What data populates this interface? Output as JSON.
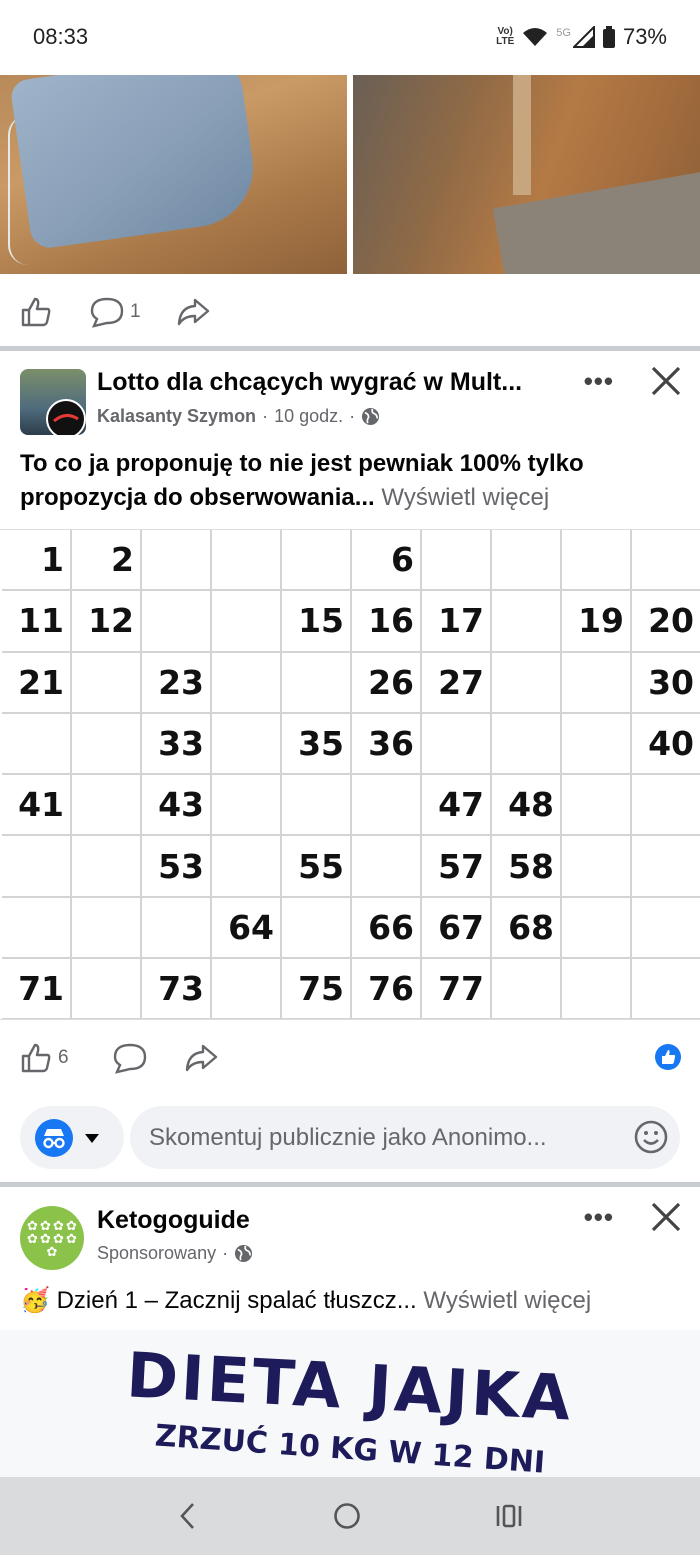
{
  "status_bar": {
    "time": "08:33",
    "network_top": "Vo)",
    "network_bottom": "LTE",
    "signal_5g": "5G",
    "battery": "73%"
  },
  "post1": {
    "comment_count": "1"
  },
  "post2": {
    "group_name": "Lotto dla chcących wygrać w Mult...",
    "author": "Kalasanty Szymon",
    "time": "10 godz.",
    "dot": "·",
    "body": "To co ja proponuję to nie jest pewniak 100% tylko propozycja do obserwowania...",
    "see_more": "Wyświetl więcej",
    "like_count": "6",
    "grid_rows": [
      [
        "1",
        "2",
        "",
        "",
        "",
        "6",
        "",
        "",
        "",
        ""
      ],
      [
        "11",
        "12",
        "",
        "",
        "15",
        "16",
        "17",
        "",
        "19",
        "20"
      ],
      [
        "21",
        "",
        "23",
        "",
        "",
        "26",
        "27",
        "",
        "",
        "30"
      ],
      [
        "",
        "",
        "33",
        "",
        "35",
        "36",
        "",
        "",
        "",
        "40"
      ],
      [
        "41",
        "",
        "43",
        "",
        "",
        "",
        "47",
        "48",
        "",
        ""
      ],
      [
        "",
        "",
        "53",
        "",
        "55",
        "",
        "57",
        "58",
        "",
        ""
      ],
      [
        "",
        "",
        "",
        "64",
        "",
        "66",
        "67",
        "68",
        "",
        ""
      ],
      [
        "71",
        "",
        "73",
        "",
        "75",
        "76",
        "77",
        "",
        "",
        ""
      ]
    ]
  },
  "comment_box": {
    "placeholder": "Skomentuj publicznie jako Anonimo..."
  },
  "sponsored": {
    "name": "Ketogoguide",
    "label": "Sponsorowany",
    "dot": "·",
    "emoji": "🥳",
    "body": "Dzień 1 – Zacznij spalać tłuszcz...",
    "see_more": "Wyświetl więcej",
    "ad_title": "DIETA JAJKA",
    "ad_subtitle": "ZRZUĆ 10 KG W 12 DNI"
  },
  "colors": {
    "separator": "#c9ccd1",
    "secondary_text": "#65676b",
    "reaction_blue": "#1877f2"
  },
  "icons": [
    "like-icon",
    "comment-icon",
    "share-icon",
    "globe-icon",
    "more-icon",
    "close-icon",
    "incognito-icon",
    "dropdown-icon",
    "emoji-icon",
    "back-icon",
    "home-icon",
    "recents-icon"
  ]
}
